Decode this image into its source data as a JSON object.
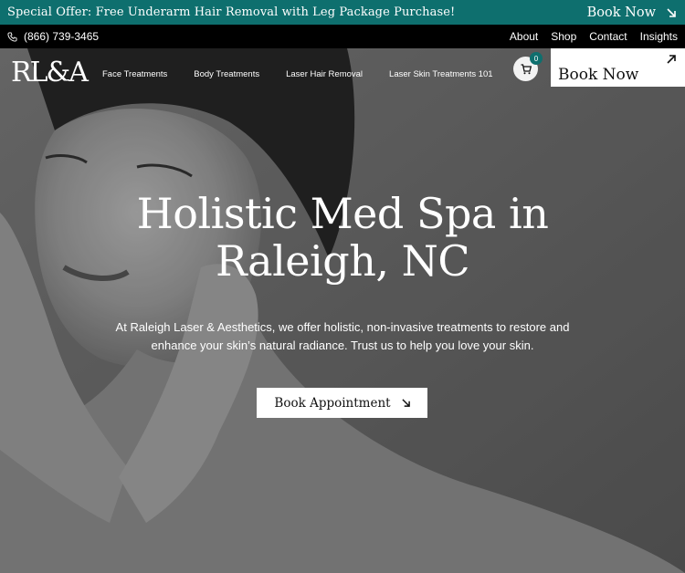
{
  "promo": {
    "text": "Special Offer: Free Underarm Hair Removal with Leg Package Purchase!",
    "book_label": "Book Now"
  },
  "utility": {
    "phone": "(866) 739-3465",
    "links": [
      "About",
      "Shop",
      "Contact",
      "Insights"
    ]
  },
  "nav": {
    "logo": "RL&A",
    "items": [
      "Face Treatments",
      "Body Treatments",
      "Laser Hair Removal",
      "Laser Skin Treatments 101"
    ],
    "cart_count": "0",
    "book_now": "Book Now"
  },
  "hero": {
    "headline_line1": "Holistic Med Spa in",
    "headline_line2": "Raleigh, NC",
    "intro_line1": "At Raleigh Laser & Aesthetics, we offer holistic, non-invasive treatments to restore and",
    "intro_line2": "enhance your skin’s natural radiance. Trust us to help you love your skin.",
    "cta": "Book Appointment"
  },
  "colors": {
    "brand_teal": "#0e6f6e",
    "black": "#000000",
    "white": "#ffffff"
  }
}
